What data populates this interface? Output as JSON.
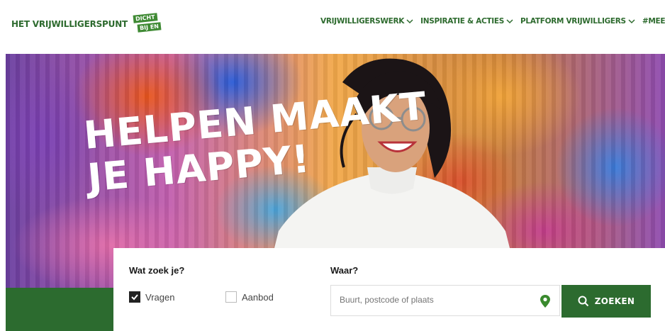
{
  "header": {
    "logo_text": "HET VRIJWILLIGERSPUNT",
    "logo_badge_line1": "DICHT",
    "logo_badge_line2": "BIJ EN",
    "nav": [
      {
        "label": "VRIJWILLIGERSWERK"
      },
      {
        "label": "INSPIRATIE & ACTIES"
      },
      {
        "label": "PLATFORM VRIJWILLIGERS"
      },
      {
        "label": "#MEEDO"
      }
    ]
  },
  "hero": {
    "slogan_line1": "HELPEN MAAKT",
    "slogan_line2": "JE HAPPY!"
  },
  "search": {
    "what_label": "Wat zoek je?",
    "where_label": "Waar?",
    "options": [
      {
        "label": "Vragen",
        "checked": true
      },
      {
        "label": "Aanbod",
        "checked": false
      }
    ],
    "where_placeholder": "Buurt, postcode of plaats",
    "button_label": "ZOEKEN"
  },
  "colors": {
    "brand_green": "#2c6b2f",
    "logo_green": "#3f8a34",
    "pin_green": "#3a8a2e"
  }
}
